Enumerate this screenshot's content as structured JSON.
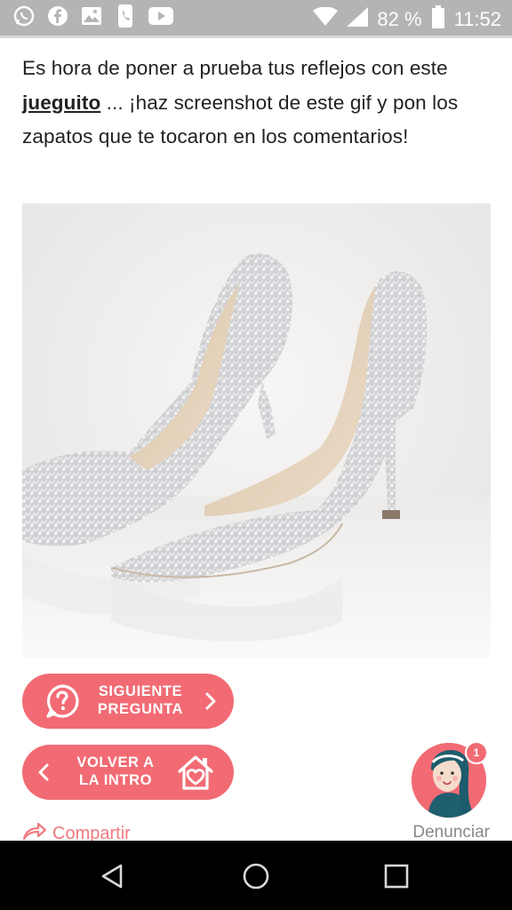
{
  "status_bar": {
    "left_icons": [
      "whatsapp-icon",
      "facebook-icon",
      "gallery-icon",
      "phone-app-icon",
      "youtube-icon"
    ],
    "battery_percent": "82 %",
    "time": "11:52"
  },
  "post": {
    "text_before_link": "Es hora de poner a prueba tus reflejos con este ",
    "link_text": "jueguito",
    "text_after_link": " ... ¡haz screenshot de este gif y pon los zapatos que te tocaron en los comentarios!"
  },
  "image": {
    "subject": "glitter-high-heel-shoes"
  },
  "buttons": {
    "next_line1": "SIGUIENTE",
    "next_line2": "PREGUNTA",
    "back_line1": "VOLVER A",
    "back_line2": "LA INTRO"
  },
  "actions": {
    "share": "Compartir",
    "report": "Denunciar"
  },
  "assistant": {
    "badge_count": "1"
  },
  "colors": {
    "accent": "#f26b74",
    "status_bar": "#b4b4b4",
    "nav_bar": "#000000"
  }
}
